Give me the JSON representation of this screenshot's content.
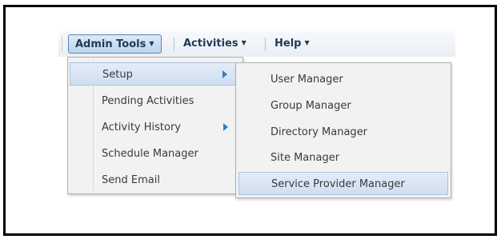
{
  "menubar": {
    "items": [
      {
        "label": "Admin Tools",
        "caret": "▼"
      },
      {
        "label": "Activities",
        "caret": "▼"
      },
      {
        "label": "Help",
        "caret": "▼"
      }
    ]
  },
  "admin_menu": {
    "items": [
      {
        "label": "Setup",
        "has_submenu": true,
        "highlighted": true
      },
      {
        "label": "Pending Activities",
        "has_submenu": false
      },
      {
        "label": "Activity History",
        "has_submenu": true
      },
      {
        "label": "Schedule Manager",
        "has_submenu": false
      },
      {
        "label": "Send Email",
        "has_submenu": false
      }
    ]
  },
  "setup_submenu": {
    "items": [
      {
        "label": "User Manager"
      },
      {
        "label": "Group Manager"
      },
      {
        "label": "Directory Manager"
      },
      {
        "label": "Site Manager"
      },
      {
        "label": "Service Provider Manager",
        "highlighted": true
      }
    ]
  },
  "colors": {
    "menu_text": "#1f3a5a",
    "active_border": "#5a84b8",
    "submenu_arrow": "#2f7fc6",
    "dropdown_bg": "#f2f2f2"
  }
}
